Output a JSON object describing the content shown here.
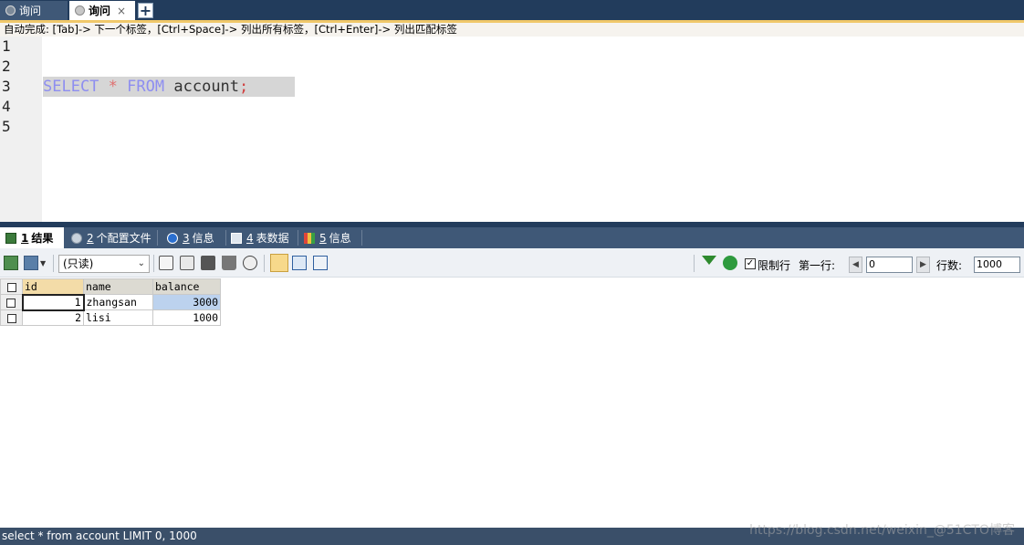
{
  "query_tabs": [
    {
      "label": "询问",
      "active": false
    },
    {
      "label": "询问",
      "active": true,
      "close": "×"
    }
  ],
  "new_tab_label": "+",
  "autocomplete_hint": "自动完成: [Tab]-> 下一个标签，[Ctrl+Space]-> 列出所有标签，[Ctrl+Enter]-> 列出匹配标签",
  "editor": {
    "line_numbers": [
      "1",
      "2",
      "3",
      "4",
      "5"
    ],
    "code_tokens": {
      "kw1": "SELECT",
      "op": "*",
      "kw2": "FROM",
      "ident": "account",
      "semi": ";"
    }
  },
  "result_tabs": [
    {
      "num": "1",
      "label": "结果",
      "icon": "result-grid-icon",
      "active": true
    },
    {
      "num": "2",
      "label": "个配置文件",
      "icon": "profile-icon",
      "active": false
    },
    {
      "num": "3",
      "label": "信息",
      "icon": "info-icon",
      "active": false
    },
    {
      "num": "4",
      "label": "表数据",
      "icon": "table-data-icon",
      "active": false
    },
    {
      "num": "5",
      "label": "信息",
      "icon": "info-blocks-icon",
      "active": false
    }
  ],
  "toolbar": {
    "mode_value": "(只读)",
    "limit_label": "限制行",
    "limit_checked": true,
    "first_row_label": "第一行:",
    "first_row_value": "0",
    "rows_label": "行数:",
    "rows_value": "1000"
  },
  "grid": {
    "columns": [
      "id",
      "name",
      "balance"
    ],
    "rows": [
      {
        "id": "1",
        "name": "zhangsan",
        "balance": "3000"
      },
      {
        "id": "2",
        "name": "lisi",
        "balance": "1000"
      }
    ]
  },
  "status_text": "select * from account LIMIT 0, 1000",
  "watermark": "https://blog.csdn.net/weixin_@51CTO博客",
  "colors": {
    "dark_navy": "#223c5c",
    "accent": "#f0c86a",
    "keyword": "#8e8ef0",
    "selection": "#bcd2ee"
  }
}
